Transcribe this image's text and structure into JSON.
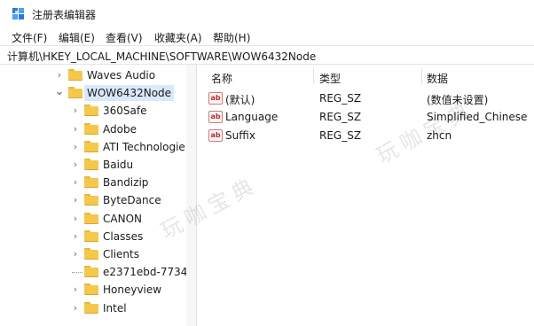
{
  "window": {
    "title": "注册表编辑器",
    "icon": "registry-editor-icon"
  },
  "menu": {
    "items": [
      "文件(F)",
      "编辑(E)",
      "查看(V)",
      "收藏夹(A)",
      "帮助(H)"
    ]
  },
  "address": {
    "path": "计算机\\HKEY_LOCAL_MACHINE\\SOFTWARE\\WOW6432Node"
  },
  "tree": {
    "items": [
      {
        "label": "Waves Audio",
        "expander": "collapsed",
        "depth": 1,
        "selected": false
      },
      {
        "label": "WOW6432Node",
        "expander": "expanded",
        "depth": 1,
        "selected": true
      },
      {
        "label": "360Safe",
        "expander": "collapsed",
        "depth": 2,
        "selected": false
      },
      {
        "label": "Adobe",
        "expander": "collapsed",
        "depth": 2,
        "selected": false
      },
      {
        "label": "ATI Technologie",
        "expander": "collapsed",
        "depth": 2,
        "selected": false
      },
      {
        "label": "Baidu",
        "expander": "collapsed",
        "depth": 2,
        "selected": false
      },
      {
        "label": "Bandizip",
        "expander": "collapsed",
        "depth": 2,
        "selected": false
      },
      {
        "label": "ByteDance",
        "expander": "collapsed",
        "depth": 2,
        "selected": false
      },
      {
        "label": "CANON",
        "expander": "collapsed",
        "depth": 2,
        "selected": false
      },
      {
        "label": "Classes",
        "expander": "collapsed",
        "depth": 2,
        "selected": false
      },
      {
        "label": "Clients",
        "expander": "collapsed",
        "depth": 2,
        "selected": false
      },
      {
        "label": "e2371ebd-7734",
        "expander": "none",
        "depth": 2,
        "selected": false
      },
      {
        "label": "Honeyview",
        "expander": "collapsed",
        "depth": 2,
        "selected": false
      },
      {
        "label": "Intel",
        "expander": "collapsed",
        "depth": 2,
        "selected": false
      }
    ]
  },
  "list": {
    "headers": {
      "name": "名称",
      "type": "类型",
      "data": "数据"
    },
    "rows": [
      {
        "name": "(默认)",
        "type": "REG_SZ",
        "data": "(数值未设置)",
        "icon": "ab"
      },
      {
        "name": "Language",
        "type": "REG_SZ",
        "data": "Simplified_Chinese",
        "icon": "ab"
      },
      {
        "name": "Suffix",
        "type": "REG_SZ",
        "data": "zhcn",
        "icon": "ab"
      }
    ]
  },
  "watermark": {
    "text": "玩咖宝典"
  },
  "colors": {
    "selection": "#d9e8fb",
    "folder": "#f5c84c",
    "string_icon": "#b03030"
  }
}
